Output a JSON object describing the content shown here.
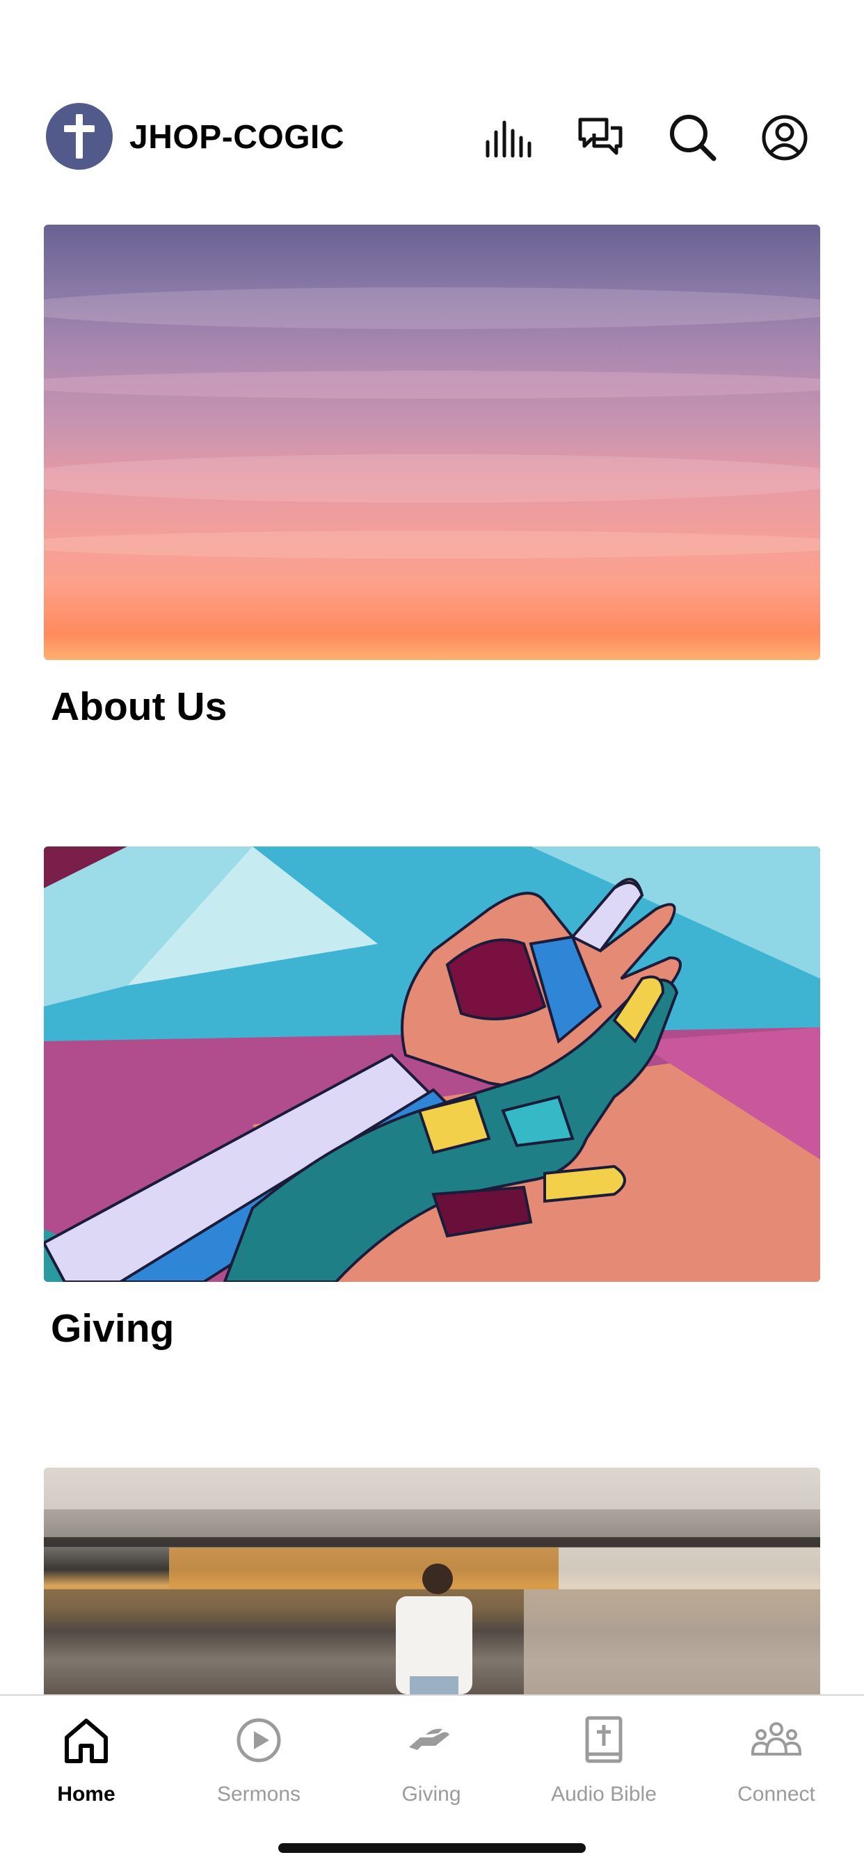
{
  "app": {
    "title": "JHOP-COGIC",
    "brand_color": "#525a8b"
  },
  "header": {
    "icons": [
      "audio-wave-icon",
      "chat-icon",
      "search-icon",
      "profile-icon"
    ]
  },
  "cards": [
    {
      "title": "About Us",
      "image": "sunset-sky-photo"
    },
    {
      "title": "Giving",
      "image": "painted-hands-mural"
    },
    {
      "title": "",
      "image": "train-station-photo"
    }
  ],
  "tabbar": {
    "active": "Home",
    "active_color": "#000000",
    "inactive_color": "#9b9b9b",
    "items": [
      {
        "label": "Home",
        "icon": "home-icon"
      },
      {
        "label": "Sermons",
        "icon": "play-circle-icon"
      },
      {
        "label": "Giving",
        "icon": "giving-hand-icon"
      },
      {
        "label": "Audio Bible",
        "icon": "bible-icon"
      },
      {
        "label": "Connect",
        "icon": "group-icon"
      }
    ]
  }
}
